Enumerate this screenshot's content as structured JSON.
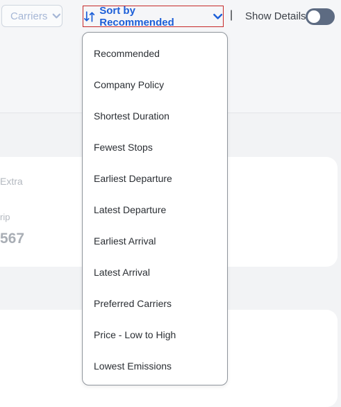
{
  "toolbar": {
    "carriers_label": "Carriers",
    "sort_label": "Sort by Recommended",
    "separator": "|",
    "show_details_label": "Show Details"
  },
  "sort_menu": {
    "options": [
      "Recommended",
      "Company Policy",
      "Shortest Duration",
      "Fewest Stops",
      "Earliest Departure",
      "Latest Departure",
      "Earliest Arrival",
      "Latest Arrival",
      "Preferred Carriers",
      "Price - Low to High",
      "Lowest Emissions"
    ]
  },
  "results": {
    "card1": {
      "fare_label": "Extra",
      "trip_label": "rip",
      "price": "567"
    }
  },
  "colors": {
    "accent": "#1c5fd8",
    "highlight_border": "#c62828",
    "toggle_bg": "#5d6b82"
  },
  "icons": {
    "sort": "sort-arrows-icon",
    "chevron": "chevron-down-icon"
  }
}
